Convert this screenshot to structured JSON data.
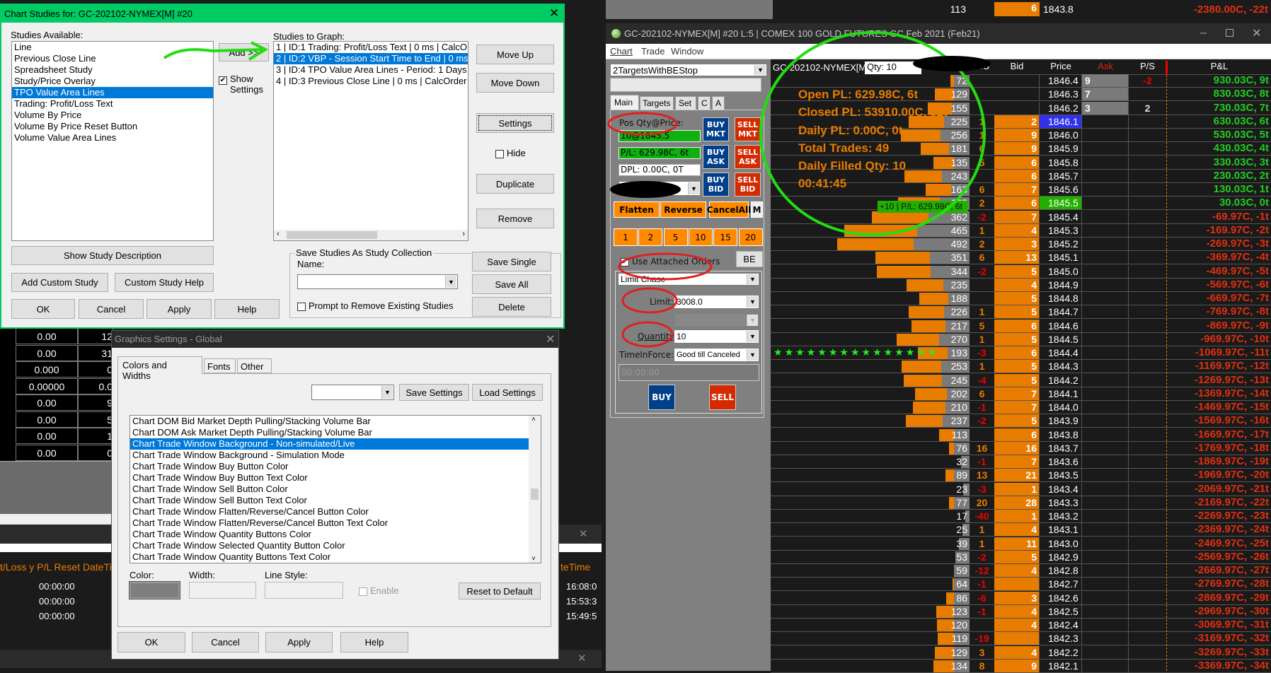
{
  "top_strip": {
    "vol": "113",
    "bid": "6",
    "price": "1843.8",
    "pnl": "-2380.00C, -22t"
  },
  "studies_dialog": {
    "title": "Chart Studies for: GC-202102-NYMEX[M]  #20",
    "available_label": "Studies Available:",
    "available": [
      "Line",
      "Previous Close Line",
      "Spreadsheet Study",
      "Study/Price Overlay",
      "TPO Value Area Lines",
      "Trading: Profit/Loss Text",
      "Volume By Price",
      "Volume By Price Reset Button",
      "Volume Value Area Lines"
    ],
    "available_selected": "TPO Value Area Lines",
    "add_label": "Add >>",
    "show_settings_label": "Show Settings",
    "graph_label": "Studies to Graph:",
    "graph": [
      "1 | ID:1  Trading: Profit/Loss Text | 0 ms | CalcO",
      "2 | ID:2  VBP - Session Start Time to End | 0 ms",
      "3 | ID:4  TPO Value Area Lines - Period: 1 Days",
      "4 | ID:3  Previous Close Line | 0 ms | CalcOrder"
    ],
    "graph_selected": "2 | ID:2  VBP - Session Start Time to End | 0 ms",
    "move_up": "Move Up",
    "move_down": "Move Down",
    "settings": "Settings",
    "hide": "Hide",
    "duplicate": "Duplicate",
    "remove": "Remove",
    "show_desc": "Show Study Description",
    "add_custom": "Add Custom Study",
    "custom_help": "Custom Study Help",
    "ok": "OK",
    "cancel": "Cancel",
    "apply": "Apply",
    "help": "Help",
    "save_group": "Save Studies As Study Collection",
    "name_label": "Name:",
    "name_value": "",
    "prompt": "Prompt to Remove Existing Studies",
    "save_single": "Save Single",
    "save_all": "Save All",
    "delete": "Delete"
  },
  "graphics_dialog": {
    "title": "Graphics Settings - Global",
    "tabs": [
      "Colors and Widths",
      "Fonts",
      "Other"
    ],
    "active_tab": "Colors and Widths",
    "save_settings": "Save Settings",
    "load_settings": "Load Settings",
    "items": [
      "Chart DOM Bid Market Depth Pulling/Stacking Volume Bar",
      "Chart DOM Ask Market Depth Pulling/Stacking Volume Bar",
      "Chart Trade Window Background - Non-simulated/Live",
      "Chart Trade Window Background - Simulation Mode",
      "Chart Trade Window Buy Button Color",
      "Chart Trade Window Buy Button Text Color",
      "Chart Trade Window Sell Button Color",
      "Chart Trade Window Sell Button Text Color",
      "Chart Trade Window Flatten/Reverse/Cancel Button Color",
      "Chart Trade Window Flatten/Reverse/Cancel Button Text Color",
      "Chart Trade Window Quantity Buttons Color",
      "Chart Trade Window Selected Quantity Button Color",
      "Chart Trade Window Quantity Buttons Text Color"
    ],
    "selected": "Chart Trade Window Background - Non-simulated/Live",
    "color_label": "Color:",
    "width_label": "Width:",
    "line_style_label": "Line Style:",
    "enable": "Enable",
    "reset": "Reset to Default",
    "color_value": "#7f7f7f",
    "ok": "OK",
    "cancel": "Cancel",
    "apply": "Apply",
    "help": "Help"
  },
  "bg_table": {
    "col1": [
      "0.00",
      "0.00",
      "0.000",
      "0.00000",
      "0.00",
      "0.00",
      "0.00",
      "0.00"
    ],
    "col2": [
      "12",
      "31",
      "0",
      "0.0",
      "9",
      "5",
      "1",
      "0"
    ]
  },
  "bg_window": {
    "header": "t/Loss y P/L Reset DateTi",
    "header_right": "teTime",
    "times": [
      "00:00:00",
      "00:00:00",
      "00:00:00"
    ],
    "right_times": [
      "16:08:0",
      "15:53:3",
      "15:49:5"
    ],
    "close": "✕"
  },
  "main_window": {
    "title": "GC-202102-NYMEX[M]  #20 L:5 | COMEX 100 GOLD FUTURES GC Feb 2021 (Feb21)",
    "menu": [
      "Chart",
      "Trade",
      "Window"
    ],
    "symbol": "GC-202102-NYMEX[M]",
    "qty": "Qty: 10",
    "columns": {
      "ps_bid": "P/S",
      "bid": "Bid",
      "price": "Price",
      "ask": "Ask",
      "ps_ask": "P/S",
      "pnl": "P&L"
    }
  },
  "trade_panel": {
    "strategy": "2TargetsWithBEStop",
    "tabs": [
      "Main",
      "Targets",
      "Set",
      "C",
      "A"
    ],
    "pos_label": "Pos Qty@Price:",
    "pos_value": "10@1845.5",
    "pl_value": "P/L: 629.98C, 6t",
    "dpl_value": "DPL: 0.00C, 0T",
    "buy_mkt": "BUY MKT",
    "sell_mkt": "SELL MKT",
    "buy_ask": "BUY ASK",
    "sell_ask": "SELL ASK",
    "buy_bid": "BUY BID",
    "sell_bid": "SELL BID",
    "flatten": "Flatten",
    "reverse": "Reverse",
    "cancel_all": "CancelAll",
    "m": "M",
    "qty_buttons": [
      "1",
      "2",
      "5",
      "10",
      "15",
      "20"
    ],
    "qty_selected": "10",
    "attached": "Use Attached Orders",
    "attached_checked": true,
    "be": "BE",
    "order_type": "Limit Chase",
    "limit_label": "Limit:",
    "limit_value": "3008.0",
    "quantity_label": "Quantity:",
    "quantity_value": "10",
    "tif_label": "TimeInForce:",
    "tif_value": "Good till Canceled",
    "time_value": "00:00:00",
    "buy": "BUY",
    "sell": "SELL"
  },
  "overlay": {
    "lines": [
      "Open PL: 629.98C, 6t",
      "Closed PL: 53910.00C, 52t",
      "Daily PL: 0.00C, 0t",
      "Total Trades: 49",
      "Daily Filled Qty: 10",
      "00:41:45"
    ],
    "position_label": "+10 | P/L: 629.98C, 6t"
  },
  "colors": {
    "positive": "#22cc22",
    "negative": "#e03010",
    "orange": "#e87c00",
    "buy": "#003f8a",
    "sell": "#d42a00",
    "studies_title": "#00cc66"
  },
  "ladder": {
    "current_price": "1846.1",
    "position_price": "1845.5",
    "star_price": "1844.4",
    "rows": [
      {
        "price": "1846.4",
        "vol": 72,
        "ps_bid": "",
        "bid": "",
        "ask": "9",
        "ps_ask": "-2",
        "pnl": "930.03C, 9t"
      },
      {
        "price": "1846.3",
        "vol": 129,
        "ps_bid": "",
        "bid": "",
        "ask": "7",
        "ps_ask": "",
        "pnl": "830.03C, 8t"
      },
      {
        "price": "1846.2",
        "vol": 155,
        "ps_bid": "",
        "bid": "",
        "ask": "3",
        "ps_ask": "2",
        "pnl": "730.03C, 7t"
      },
      {
        "price": "1846.1",
        "vol": 225,
        "ps_bid": "1",
        "bid": "2",
        "ask": "",
        "ps_ask": "",
        "pnl": "630.03C, 6t"
      },
      {
        "price": "1846.0",
        "vol": 256,
        "ps_bid": "1",
        "bid": "9",
        "ask": "",
        "ps_ask": "",
        "pnl": "530.03C, 5t"
      },
      {
        "price": "1845.9",
        "vol": 181,
        "ps_bid": "6",
        "bid": "9",
        "ask": "",
        "ps_ask": "",
        "pnl": "430.03C, 4t"
      },
      {
        "price": "1845.8",
        "vol": 135,
        "ps_bid": "5",
        "bid": "6",
        "ask": "",
        "ps_ask": "",
        "pnl": "330.03C, 3t"
      },
      {
        "price": "1845.7",
        "vol": 243,
        "ps_bid": "",
        "bid": "6",
        "ask": "",
        "ps_ask": "",
        "pnl": "230.03C, 2t"
      },
      {
        "price": "1845.6",
        "vol": 163,
        "ps_bid": "6",
        "bid": "7",
        "ask": "",
        "ps_ask": "",
        "pnl": "130.03C, 1t"
      },
      {
        "price": "1845.5",
        "vol": 265,
        "ps_bid": "2",
        "bid": "6",
        "ask": "",
        "ps_ask": "",
        "pnl": "30.03C, 0t"
      },
      {
        "price": "1845.4",
        "vol": 362,
        "ps_bid": "-2",
        "bid": "7",
        "ask": "",
        "ps_ask": "",
        "pnl": "-69.97C, -1t"
      },
      {
        "price": "1845.3",
        "vol": 465,
        "ps_bid": "1",
        "bid": "4",
        "ask": "",
        "ps_ask": "",
        "pnl": "-169.97C, -2t"
      },
      {
        "price": "1845.2",
        "vol": 492,
        "ps_bid": "2",
        "bid": "3",
        "ask": "",
        "ps_ask": "",
        "pnl": "-269.97C, -3t"
      },
      {
        "price": "1845.1",
        "vol": 351,
        "ps_bid": "6",
        "bid": "13",
        "ask": "",
        "ps_ask": "",
        "pnl": "-369.97C, -4t"
      },
      {
        "price": "1845.0",
        "vol": 344,
        "ps_bid": "-2",
        "bid": "5",
        "ask": "",
        "ps_ask": "",
        "pnl": "-469.97C, -5t"
      },
      {
        "price": "1844.9",
        "vol": 235,
        "ps_bid": "",
        "bid": "4",
        "ask": "",
        "ps_ask": "",
        "pnl": "-569.97C, -6t"
      },
      {
        "price": "1844.8",
        "vol": 188,
        "ps_bid": "",
        "bid": "5",
        "ask": "",
        "ps_ask": "",
        "pnl": "-669.97C, -7t"
      },
      {
        "price": "1844.7",
        "vol": 226,
        "ps_bid": "1",
        "bid": "5",
        "ask": "",
        "ps_ask": "",
        "pnl": "-769.97C, -8t"
      },
      {
        "price": "1844.6",
        "vol": 217,
        "ps_bid": "5",
        "bid": "6",
        "ask": "",
        "ps_ask": "",
        "pnl": "-869.97C, -9t"
      },
      {
        "price": "1844.5",
        "vol": 270,
        "ps_bid": "1",
        "bid": "5",
        "ask": "",
        "ps_ask": "",
        "pnl": "-969.97C, -10t"
      },
      {
        "price": "1844.4",
        "vol": 193,
        "ps_bid": "-3",
        "bid": "6",
        "ask": "",
        "ps_ask": "",
        "pnl": "-1069.97C, -11t"
      },
      {
        "price": "1844.3",
        "vol": 253,
        "ps_bid": "1",
        "bid": "5",
        "ask": "",
        "ps_ask": "",
        "pnl": "-1169.97C, -12t"
      },
      {
        "price": "1844.2",
        "vol": 245,
        "ps_bid": "-4",
        "bid": "5",
        "ask": "",
        "ps_ask": "",
        "pnl": "-1269.97C, -13t"
      },
      {
        "price": "1844.1",
        "vol": 202,
        "ps_bid": "6",
        "bid": "7",
        "ask": "",
        "ps_ask": "",
        "pnl": "-1369.97C, -14t"
      },
      {
        "price": "1844.0",
        "vol": 210,
        "ps_bid": "-1",
        "bid": "7",
        "ask": "",
        "ps_ask": "",
        "pnl": "-1469.97C, -15t"
      },
      {
        "price": "1843.9",
        "vol": 237,
        "ps_bid": "-2",
        "bid": "5",
        "ask": "",
        "ps_ask": "",
        "pnl": "-1569.97C, -16t"
      },
      {
        "price": "1843.8",
        "vol": 113,
        "ps_bid": "",
        "bid": "6",
        "ask": "",
        "ps_ask": "",
        "pnl": "-1669.97C, -17t"
      },
      {
        "price": "1843.7",
        "vol": 76,
        "ps_bid": "16",
        "bid": "16",
        "ask": "",
        "ps_ask": "",
        "pnl": "-1769.97C, -18t"
      },
      {
        "price": "1843.6",
        "vol": 32,
        "ps_bid": "-1",
        "bid": "7",
        "ask": "",
        "ps_ask": "",
        "pnl": "-1869.97C, -19t"
      },
      {
        "price": "1843.5",
        "vol": 89,
        "ps_bid": "13",
        "bid": "21",
        "ask": "",
        "ps_ask": "",
        "pnl": "-1969.97C, -20t"
      },
      {
        "price": "1843.4",
        "vol": 23,
        "ps_bid": "-3",
        "bid": "1",
        "ask": "",
        "ps_ask": "",
        "pnl": "-2069.97C, -21t"
      },
      {
        "price": "1843.3",
        "vol": 77,
        "ps_bid": "20",
        "bid": "28",
        "ask": "",
        "ps_ask": "",
        "pnl": "-2169.97C, -22t"
      },
      {
        "price": "1843.2",
        "vol": 17,
        "ps_bid": "-40",
        "bid": "1",
        "ask": "",
        "ps_ask": "",
        "pnl": "-2269.97C, -23t"
      },
      {
        "price": "1843.1",
        "vol": 25,
        "ps_bid": "1",
        "bid": "4",
        "ask": "",
        "ps_ask": "",
        "pnl": "-2369.97C, -24t"
      },
      {
        "price": "1843.0",
        "vol": 39,
        "ps_bid": "1",
        "bid": "11",
        "ask": "",
        "ps_ask": "",
        "pnl": "-2469.97C, -25t"
      },
      {
        "price": "1842.9",
        "vol": 53,
        "ps_bid": "-2",
        "bid": "5",
        "ask": "",
        "ps_ask": "",
        "pnl": "-2569.97C, -26t"
      },
      {
        "price": "1842.8",
        "vol": 59,
        "ps_bid": "-12",
        "bid": "4",
        "ask": "",
        "ps_ask": "",
        "pnl": "-2669.97C, -27t"
      },
      {
        "price": "1842.7",
        "vol": 64,
        "ps_bid": "-1",
        "bid": "",
        "ask": "",
        "ps_ask": "",
        "pnl": "-2769.97C, -28t"
      },
      {
        "price": "1842.6",
        "vol": 86,
        "ps_bid": "-6",
        "bid": "3",
        "ask": "",
        "ps_ask": "",
        "pnl": "-2869.97C, -29t"
      },
      {
        "price": "1842.5",
        "vol": 123,
        "ps_bid": "-1",
        "bid": "4",
        "ask": "",
        "ps_ask": "",
        "pnl": "-2969.97C, -30t"
      },
      {
        "price": "1842.4",
        "vol": 120,
        "ps_bid": "",
        "bid": "4",
        "ask": "",
        "ps_ask": "",
        "pnl": "-3069.97C, -31t"
      },
      {
        "price": "1842.3",
        "vol": 119,
        "ps_bid": "-19",
        "bid": "",
        "ask": "",
        "ps_ask": "",
        "pnl": "-3169.97C, -32t"
      },
      {
        "price": "1842.2",
        "vol": 129,
        "ps_bid": "3",
        "bid": "4",
        "ask": "",
        "ps_ask": "",
        "pnl": "-3269.97C, -33t"
      },
      {
        "price": "1842.1",
        "vol": 134,
        "ps_bid": "8",
        "bid": "9",
        "ask": "",
        "ps_ask": "",
        "pnl": "-3369.97C, -34t"
      }
    ]
  }
}
